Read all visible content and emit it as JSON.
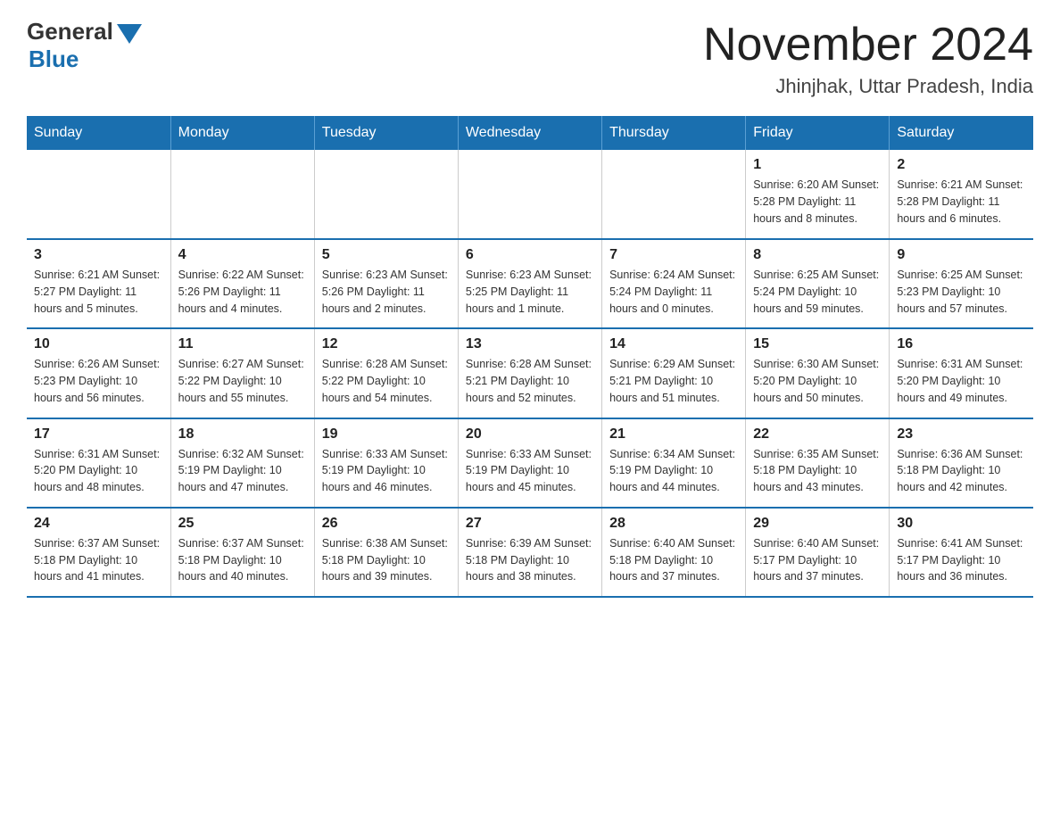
{
  "header": {
    "logo_general": "General",
    "logo_blue": "Blue",
    "title": "November 2024",
    "subtitle": "Jhinjhak, Uttar Pradesh, India"
  },
  "days_of_week": [
    "Sunday",
    "Monday",
    "Tuesday",
    "Wednesday",
    "Thursday",
    "Friday",
    "Saturday"
  ],
  "weeks": [
    [
      {
        "day": "",
        "info": ""
      },
      {
        "day": "",
        "info": ""
      },
      {
        "day": "",
        "info": ""
      },
      {
        "day": "",
        "info": ""
      },
      {
        "day": "",
        "info": ""
      },
      {
        "day": "1",
        "info": "Sunrise: 6:20 AM\nSunset: 5:28 PM\nDaylight: 11 hours and 8 minutes."
      },
      {
        "day": "2",
        "info": "Sunrise: 6:21 AM\nSunset: 5:28 PM\nDaylight: 11 hours and 6 minutes."
      }
    ],
    [
      {
        "day": "3",
        "info": "Sunrise: 6:21 AM\nSunset: 5:27 PM\nDaylight: 11 hours and 5 minutes."
      },
      {
        "day": "4",
        "info": "Sunrise: 6:22 AM\nSunset: 5:26 PM\nDaylight: 11 hours and 4 minutes."
      },
      {
        "day": "5",
        "info": "Sunrise: 6:23 AM\nSunset: 5:26 PM\nDaylight: 11 hours and 2 minutes."
      },
      {
        "day": "6",
        "info": "Sunrise: 6:23 AM\nSunset: 5:25 PM\nDaylight: 11 hours and 1 minute."
      },
      {
        "day": "7",
        "info": "Sunrise: 6:24 AM\nSunset: 5:24 PM\nDaylight: 11 hours and 0 minutes."
      },
      {
        "day": "8",
        "info": "Sunrise: 6:25 AM\nSunset: 5:24 PM\nDaylight: 10 hours and 59 minutes."
      },
      {
        "day": "9",
        "info": "Sunrise: 6:25 AM\nSunset: 5:23 PM\nDaylight: 10 hours and 57 minutes."
      }
    ],
    [
      {
        "day": "10",
        "info": "Sunrise: 6:26 AM\nSunset: 5:23 PM\nDaylight: 10 hours and 56 minutes."
      },
      {
        "day": "11",
        "info": "Sunrise: 6:27 AM\nSunset: 5:22 PM\nDaylight: 10 hours and 55 minutes."
      },
      {
        "day": "12",
        "info": "Sunrise: 6:28 AM\nSunset: 5:22 PM\nDaylight: 10 hours and 54 minutes."
      },
      {
        "day": "13",
        "info": "Sunrise: 6:28 AM\nSunset: 5:21 PM\nDaylight: 10 hours and 52 minutes."
      },
      {
        "day": "14",
        "info": "Sunrise: 6:29 AM\nSunset: 5:21 PM\nDaylight: 10 hours and 51 minutes."
      },
      {
        "day": "15",
        "info": "Sunrise: 6:30 AM\nSunset: 5:20 PM\nDaylight: 10 hours and 50 minutes."
      },
      {
        "day": "16",
        "info": "Sunrise: 6:31 AM\nSunset: 5:20 PM\nDaylight: 10 hours and 49 minutes."
      }
    ],
    [
      {
        "day": "17",
        "info": "Sunrise: 6:31 AM\nSunset: 5:20 PM\nDaylight: 10 hours and 48 minutes."
      },
      {
        "day": "18",
        "info": "Sunrise: 6:32 AM\nSunset: 5:19 PM\nDaylight: 10 hours and 47 minutes."
      },
      {
        "day": "19",
        "info": "Sunrise: 6:33 AM\nSunset: 5:19 PM\nDaylight: 10 hours and 46 minutes."
      },
      {
        "day": "20",
        "info": "Sunrise: 6:33 AM\nSunset: 5:19 PM\nDaylight: 10 hours and 45 minutes."
      },
      {
        "day": "21",
        "info": "Sunrise: 6:34 AM\nSunset: 5:19 PM\nDaylight: 10 hours and 44 minutes."
      },
      {
        "day": "22",
        "info": "Sunrise: 6:35 AM\nSunset: 5:18 PM\nDaylight: 10 hours and 43 minutes."
      },
      {
        "day": "23",
        "info": "Sunrise: 6:36 AM\nSunset: 5:18 PM\nDaylight: 10 hours and 42 minutes."
      }
    ],
    [
      {
        "day": "24",
        "info": "Sunrise: 6:37 AM\nSunset: 5:18 PM\nDaylight: 10 hours and 41 minutes."
      },
      {
        "day": "25",
        "info": "Sunrise: 6:37 AM\nSunset: 5:18 PM\nDaylight: 10 hours and 40 minutes."
      },
      {
        "day": "26",
        "info": "Sunrise: 6:38 AM\nSunset: 5:18 PM\nDaylight: 10 hours and 39 minutes."
      },
      {
        "day": "27",
        "info": "Sunrise: 6:39 AM\nSunset: 5:18 PM\nDaylight: 10 hours and 38 minutes."
      },
      {
        "day": "28",
        "info": "Sunrise: 6:40 AM\nSunset: 5:18 PM\nDaylight: 10 hours and 37 minutes."
      },
      {
        "day": "29",
        "info": "Sunrise: 6:40 AM\nSunset: 5:17 PM\nDaylight: 10 hours and 37 minutes."
      },
      {
        "day": "30",
        "info": "Sunrise: 6:41 AM\nSunset: 5:17 PM\nDaylight: 10 hours and 36 minutes."
      }
    ]
  ]
}
